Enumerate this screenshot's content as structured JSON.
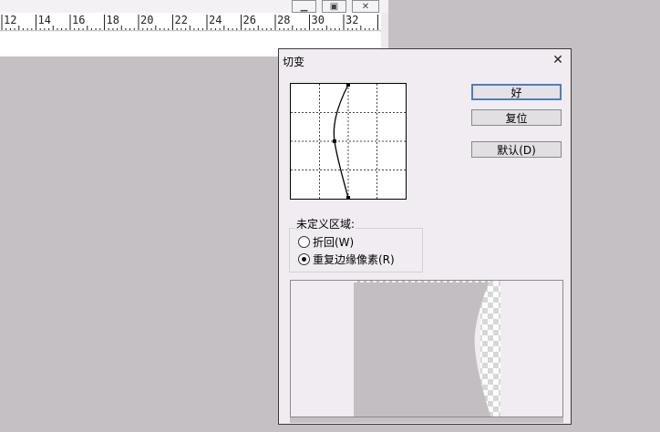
{
  "background_window": {
    "ruler_numbers": [
      "12",
      "14",
      "16",
      "18",
      "20",
      "22",
      "24",
      "26",
      "28",
      "30",
      "32"
    ],
    "controls": {
      "minimize_icon": "minimize-icon",
      "restore_icon": "restore-icon",
      "close_icon": "close-icon"
    }
  },
  "dialog": {
    "title": "切变",
    "close_glyph": "✕",
    "buttons": {
      "ok": "好",
      "reset": "复位",
      "default": "默认(D)"
    },
    "undefined_area": {
      "label": "未定义区域:",
      "options": [
        {
          "label": "折回(W)",
          "checked": false
        },
        {
          "label": "重复边缘像素(R)",
          "checked": true
        }
      ]
    }
  },
  "colors": {
    "desktop_bg": "#c4c0c4",
    "dialog_bg": "#f0ecf1",
    "default_button_border": "#4a7fc0",
    "preview_gray": "#c2bec2"
  }
}
